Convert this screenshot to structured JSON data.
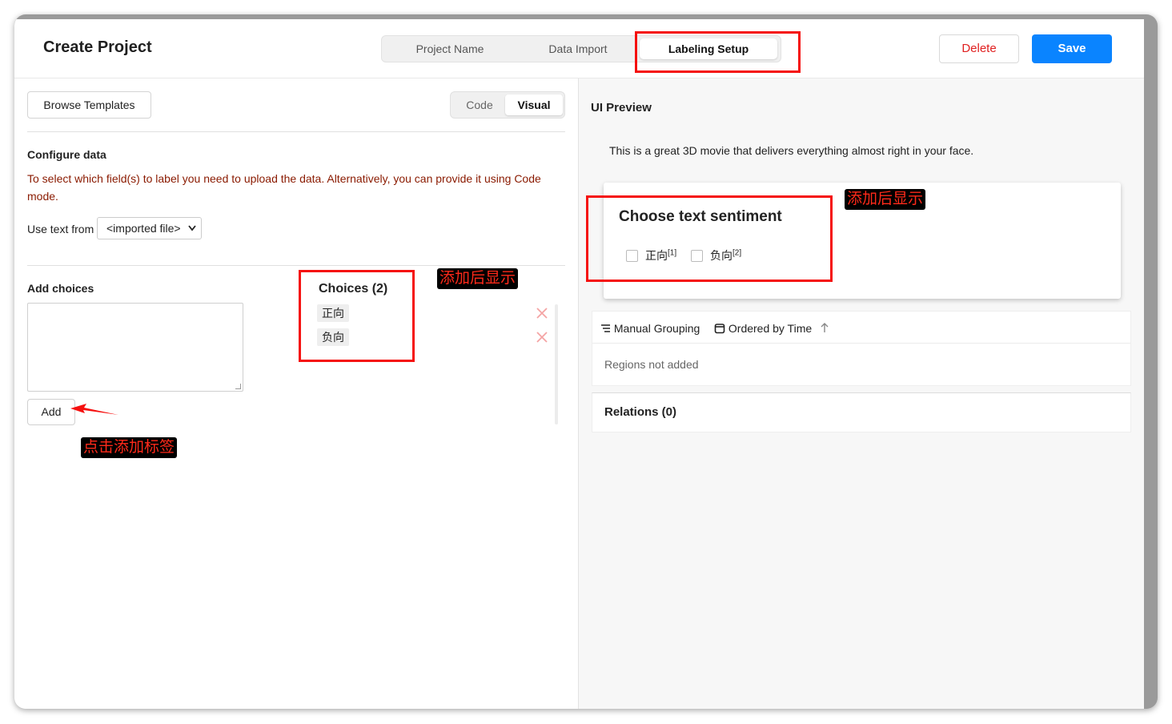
{
  "header": {
    "title": "Create Project",
    "steps": [
      "Project Name",
      "Data Import",
      "Labeling Setup"
    ],
    "active_step": "Labeling Setup",
    "delete_label": "Delete",
    "save_label": "Save"
  },
  "left": {
    "browse_templates_label": "Browse Templates",
    "view_toggle": {
      "code": "Code",
      "visual": "Visual",
      "active": "Visual"
    },
    "configure_title": "Configure data",
    "warning_text": "To select which field(s) to label you need to upload the data. Alternatively, you can provide it using Code mode.",
    "use_text_label": "Use text from",
    "select_value": "<imported file>",
    "add_choices_title": "Add choices",
    "add_label": "Add",
    "choices_title": "Choices (2)",
    "choices": [
      "正向",
      "负向"
    ]
  },
  "right": {
    "preview_title": "UI Preview",
    "sample_text": "This is a great 3D movie that delivers everything almost right in your face.",
    "card_title": "Choose text sentiment",
    "options": [
      {
        "label": "正向",
        "hotkey": "[1]"
      },
      {
        "label": "负向",
        "hotkey": "[2]"
      }
    ],
    "manual_grouping": "Manual Grouping",
    "ordered_by_time": "Ordered by Time",
    "regions_empty": "Regions not added",
    "relations_title": "Relations (0)"
  },
  "annotations": {
    "after_add_show_1": "添加后显示",
    "after_add_show_2": "添加后显示",
    "click_to_add": "点击添加标签"
  },
  "colors": {
    "accent": "#0a84ff",
    "danger": "#e02020",
    "annotation_red": "#f5100f",
    "warning_text": "#8a1a00"
  }
}
